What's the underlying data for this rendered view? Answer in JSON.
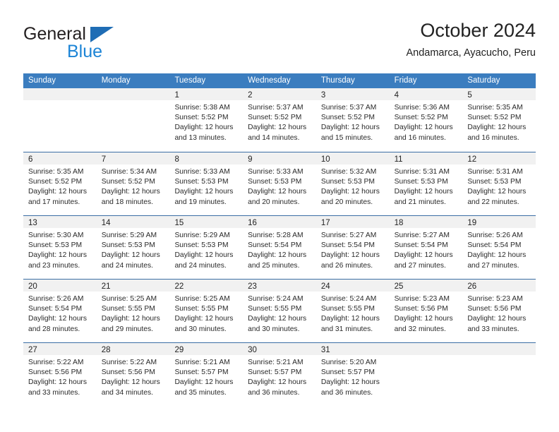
{
  "brand": {
    "name_part1": "General",
    "name_part2": "Blue",
    "triangle_color": "#1f6db5",
    "blue_color": "#1c84d6"
  },
  "header": {
    "title": "October 2024",
    "subtitle": "Andamarca, Ayacucho, Peru"
  },
  "calendar": {
    "header_bg": "#3b7dbf",
    "row_divider": "#3b6ea5",
    "daynum_bg": "#f1f1f1",
    "weekdays": [
      "Sunday",
      "Monday",
      "Tuesday",
      "Wednesday",
      "Thursday",
      "Friday",
      "Saturday"
    ],
    "weeks": [
      [
        {
          "day": "",
          "lines": []
        },
        {
          "day": "",
          "lines": []
        },
        {
          "day": "1",
          "lines": [
            "Sunrise: 5:38 AM",
            "Sunset: 5:52 PM",
            "Daylight: 12 hours",
            "and 13 minutes."
          ]
        },
        {
          "day": "2",
          "lines": [
            "Sunrise: 5:37 AM",
            "Sunset: 5:52 PM",
            "Daylight: 12 hours",
            "and 14 minutes."
          ]
        },
        {
          "day": "3",
          "lines": [
            "Sunrise: 5:37 AM",
            "Sunset: 5:52 PM",
            "Daylight: 12 hours",
            "and 15 minutes."
          ]
        },
        {
          "day": "4",
          "lines": [
            "Sunrise: 5:36 AM",
            "Sunset: 5:52 PM",
            "Daylight: 12 hours",
            "and 16 minutes."
          ]
        },
        {
          "day": "5",
          "lines": [
            "Sunrise: 5:35 AM",
            "Sunset: 5:52 PM",
            "Daylight: 12 hours",
            "and 16 minutes."
          ]
        }
      ],
      [
        {
          "day": "6",
          "lines": [
            "Sunrise: 5:35 AM",
            "Sunset: 5:52 PM",
            "Daylight: 12 hours",
            "and 17 minutes."
          ]
        },
        {
          "day": "7",
          "lines": [
            "Sunrise: 5:34 AM",
            "Sunset: 5:52 PM",
            "Daylight: 12 hours",
            "and 18 minutes."
          ]
        },
        {
          "day": "8",
          "lines": [
            "Sunrise: 5:33 AM",
            "Sunset: 5:53 PM",
            "Daylight: 12 hours",
            "and 19 minutes."
          ]
        },
        {
          "day": "9",
          "lines": [
            "Sunrise: 5:33 AM",
            "Sunset: 5:53 PM",
            "Daylight: 12 hours",
            "and 20 minutes."
          ]
        },
        {
          "day": "10",
          "lines": [
            "Sunrise: 5:32 AM",
            "Sunset: 5:53 PM",
            "Daylight: 12 hours",
            "and 20 minutes."
          ]
        },
        {
          "day": "11",
          "lines": [
            "Sunrise: 5:31 AM",
            "Sunset: 5:53 PM",
            "Daylight: 12 hours",
            "and 21 minutes."
          ]
        },
        {
          "day": "12",
          "lines": [
            "Sunrise: 5:31 AM",
            "Sunset: 5:53 PM",
            "Daylight: 12 hours",
            "and 22 minutes."
          ]
        }
      ],
      [
        {
          "day": "13",
          "lines": [
            "Sunrise: 5:30 AM",
            "Sunset: 5:53 PM",
            "Daylight: 12 hours",
            "and 23 minutes."
          ]
        },
        {
          "day": "14",
          "lines": [
            "Sunrise: 5:29 AM",
            "Sunset: 5:53 PM",
            "Daylight: 12 hours",
            "and 24 minutes."
          ]
        },
        {
          "day": "15",
          "lines": [
            "Sunrise: 5:29 AM",
            "Sunset: 5:53 PM",
            "Daylight: 12 hours",
            "and 24 minutes."
          ]
        },
        {
          "day": "16",
          "lines": [
            "Sunrise: 5:28 AM",
            "Sunset: 5:54 PM",
            "Daylight: 12 hours",
            "and 25 minutes."
          ]
        },
        {
          "day": "17",
          "lines": [
            "Sunrise: 5:27 AM",
            "Sunset: 5:54 PM",
            "Daylight: 12 hours",
            "and 26 minutes."
          ]
        },
        {
          "day": "18",
          "lines": [
            "Sunrise: 5:27 AM",
            "Sunset: 5:54 PM",
            "Daylight: 12 hours",
            "and 27 minutes."
          ]
        },
        {
          "day": "19",
          "lines": [
            "Sunrise: 5:26 AM",
            "Sunset: 5:54 PM",
            "Daylight: 12 hours",
            "and 27 minutes."
          ]
        }
      ],
      [
        {
          "day": "20",
          "lines": [
            "Sunrise: 5:26 AM",
            "Sunset: 5:54 PM",
            "Daylight: 12 hours",
            "and 28 minutes."
          ]
        },
        {
          "day": "21",
          "lines": [
            "Sunrise: 5:25 AM",
            "Sunset: 5:55 PM",
            "Daylight: 12 hours",
            "and 29 minutes."
          ]
        },
        {
          "day": "22",
          "lines": [
            "Sunrise: 5:25 AM",
            "Sunset: 5:55 PM",
            "Daylight: 12 hours",
            "and 30 minutes."
          ]
        },
        {
          "day": "23",
          "lines": [
            "Sunrise: 5:24 AM",
            "Sunset: 5:55 PM",
            "Daylight: 12 hours",
            "and 30 minutes."
          ]
        },
        {
          "day": "24",
          "lines": [
            "Sunrise: 5:24 AM",
            "Sunset: 5:55 PM",
            "Daylight: 12 hours",
            "and 31 minutes."
          ]
        },
        {
          "day": "25",
          "lines": [
            "Sunrise: 5:23 AM",
            "Sunset: 5:56 PM",
            "Daylight: 12 hours",
            "and 32 minutes."
          ]
        },
        {
          "day": "26",
          "lines": [
            "Sunrise: 5:23 AM",
            "Sunset: 5:56 PM",
            "Daylight: 12 hours",
            "and 33 minutes."
          ]
        }
      ],
      [
        {
          "day": "27",
          "lines": [
            "Sunrise: 5:22 AM",
            "Sunset: 5:56 PM",
            "Daylight: 12 hours",
            "and 33 minutes."
          ]
        },
        {
          "day": "28",
          "lines": [
            "Sunrise: 5:22 AM",
            "Sunset: 5:56 PM",
            "Daylight: 12 hours",
            "and 34 minutes."
          ]
        },
        {
          "day": "29",
          "lines": [
            "Sunrise: 5:21 AM",
            "Sunset: 5:57 PM",
            "Daylight: 12 hours",
            "and 35 minutes."
          ]
        },
        {
          "day": "30",
          "lines": [
            "Sunrise: 5:21 AM",
            "Sunset: 5:57 PM",
            "Daylight: 12 hours",
            "and 36 minutes."
          ]
        },
        {
          "day": "31",
          "lines": [
            "Sunrise: 5:20 AM",
            "Sunset: 5:57 PM",
            "Daylight: 12 hours",
            "and 36 minutes."
          ]
        },
        {
          "day": "",
          "lines": []
        },
        {
          "day": "",
          "lines": []
        }
      ]
    ]
  }
}
